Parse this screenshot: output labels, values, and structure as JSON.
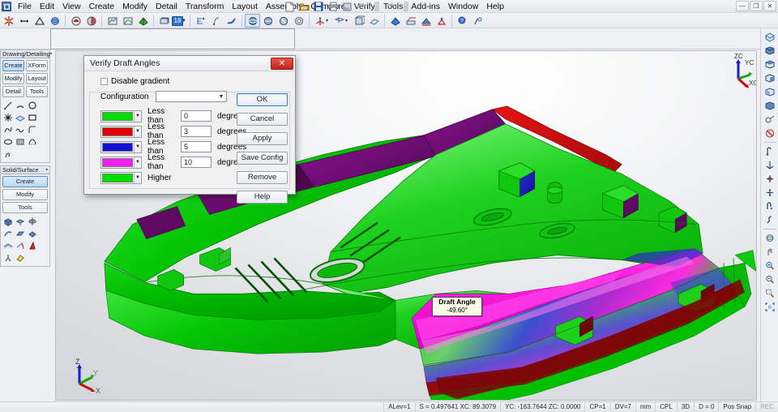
{
  "window": {
    "buttons": [
      {
        "name": "minimize",
        "glyph": "—"
      },
      {
        "name": "restore",
        "glyph": "❐"
      },
      {
        "name": "close",
        "glyph": "✕"
      }
    ]
  },
  "menubar": {
    "app_icon": "cad-app-icon",
    "items": [
      "File",
      "Edit",
      "View",
      "Create",
      "Modify",
      "Detail",
      "Transform",
      "Layout",
      "Assembly",
      "Compare",
      "Verify",
      "Tools",
      "Add-ins",
      "Window",
      "Help"
    ]
  },
  "title_icons": [
    {
      "name": "new-document-icon"
    },
    {
      "name": "open-folder-icon"
    },
    {
      "name": "save-icon"
    },
    {
      "name": "print-icon"
    },
    {
      "name": "save-as-icon"
    },
    {
      "name": "undo-icon"
    },
    {
      "name": "separator"
    },
    {
      "name": "redo-icon"
    },
    {
      "name": "separator2"
    }
  ],
  "toolbar": {
    "groups": [
      {
        "items": [
          {
            "name": "point-icon"
          },
          {
            "name": "line-icon"
          },
          {
            "name": "triangle-icon"
          },
          {
            "name": "shade-sphere-icon"
          }
        ]
      },
      {
        "items": [
          {
            "name": "render-object-icon"
          },
          {
            "name": "render-solid-icon"
          }
        ]
      },
      {
        "items": [
          {
            "name": "analysis-icon"
          },
          {
            "name": "curvature-icon"
          },
          {
            "name": "color-shade-icon"
          }
        ]
      },
      {
        "items": [
          {
            "name": "layer-icon"
          },
          {
            "name": "layer-number-button",
            "label": "18"
          },
          {
            "name": "layer-dropdown-arrow"
          }
        ]
      },
      {
        "items": [
          {
            "name": "attributes-icon"
          },
          {
            "name": "mask-icon"
          },
          {
            "name": "hook-icon"
          }
        ]
      },
      {
        "items": [
          {
            "name": "shade-mode-1-icon",
            "active": true
          },
          {
            "name": "shade-mode-2-icon"
          },
          {
            "name": "shade-mode-3-icon"
          },
          {
            "name": "shade-mode-4-icon"
          }
        ]
      },
      {
        "items": [
          {
            "name": "construction-plane-icon"
          },
          {
            "name": "cplane-arrow"
          },
          {
            "name": "view-window-icon"
          },
          {
            "name": "view-arrow"
          },
          {
            "name": "view-rotate-icon"
          },
          {
            "name": "view-plane-icon"
          }
        ]
      },
      {
        "items": [
          {
            "name": "draft-check-icon"
          },
          {
            "name": "section-icon"
          },
          {
            "name": "measure-icon"
          },
          {
            "name": "deviation-icon"
          }
        ]
      },
      {
        "items": [
          {
            "name": "help-pointer-icon"
          },
          {
            "name": "whats-this-icon"
          }
        ]
      }
    ]
  },
  "left_panels": [
    {
      "title": "Drawing/Detailing",
      "pin": "▪",
      "buttons": [
        {
          "label": "Create",
          "selected": true
        },
        {
          "label": "XForm",
          "selected": false
        },
        {
          "label": "Modify",
          "selected": false
        },
        {
          "label": "Layout",
          "selected": false
        },
        {
          "label": "Detail",
          "selected": false
        },
        {
          "label": "Tools",
          "selected": false
        }
      ],
      "icons": [
        {
          "name": "line-tool-icon"
        },
        {
          "name": "arc-tool-icon"
        },
        {
          "name": "circle-tool-icon"
        },
        {
          "name": "point-tool-icon"
        },
        {
          "name": "surface-tool-icon"
        },
        {
          "name": "rectangle-tool-icon"
        },
        {
          "name": "spline-tool-icon"
        },
        {
          "name": "curve-tool-icon"
        },
        {
          "name": "fillet-tool-icon"
        },
        {
          "name": "ellipse-tool-icon"
        },
        {
          "name": "grid-tool-icon"
        },
        {
          "name": "polyline-tool-icon"
        },
        {
          "name": "freeform-tool-icon"
        }
      ]
    },
    {
      "title": "Solid/Surface",
      "pin": "▪",
      "buttons": [
        {
          "label": "Create",
          "selected": true
        },
        {
          "label": "Modify",
          "selected": false
        },
        {
          "label": "Tools",
          "selected": false
        }
      ],
      "icons": [
        {
          "name": "box-solid-icon"
        },
        {
          "name": "extrude-solid-icon"
        },
        {
          "name": "revolve-solid-icon"
        },
        {
          "name": "sweep-solid-icon"
        },
        {
          "name": "loft-solid-icon"
        },
        {
          "name": "primitive-solid-icon"
        },
        {
          "name": "offset-surface-icon"
        },
        {
          "name": "trim-surface-icon"
        },
        {
          "name": "draft-angle-icon"
        },
        {
          "name": "split-surface-icon"
        },
        {
          "name": "patch-surface-icon"
        }
      ]
    }
  ],
  "right_toolbar": {
    "items": [
      {
        "name": "view-iso-icon"
      },
      {
        "name": "view-front-icon"
      },
      {
        "name": "view-top-icon"
      },
      {
        "name": "view-right-icon"
      },
      {
        "name": "view-back-icon"
      },
      {
        "name": "view-left-icon"
      },
      {
        "name": "view-named-icon"
      },
      {
        "name": "no-shade-icon"
      },
      {
        "name": "rotate-view-icon"
      },
      {
        "name": "axis-triad-icon"
      },
      {
        "name": "dynamic-rotate-icon"
      },
      {
        "name": "pan-center-icon"
      },
      {
        "name": "spin-view-icon"
      },
      {
        "name": "twist-view-icon"
      },
      {
        "name": "orbit-icon"
      },
      {
        "name": "pan-hand-icon"
      },
      {
        "name": "zoom-in-icon"
      },
      {
        "name": "zoom-out-icon"
      },
      {
        "name": "zoom-window-icon"
      },
      {
        "name": "zoom-fit-icon"
      }
    ]
  },
  "viewport": {
    "draft_tooltip": {
      "title": "Draft Angle",
      "value": "-49.60°"
    },
    "triad_top_right": {
      "labels": [
        "ZC",
        "YC",
        "XC"
      ]
    },
    "triad_bottom_left": {
      "labels": [
        "Z",
        "Y",
        "X"
      ]
    }
  },
  "dialog": {
    "title": "Verify Draft Angles",
    "close_glyph": "✕",
    "disable_gradient": {
      "label": "Disable gradient",
      "checked": false
    },
    "configuration": {
      "label": "Configuration",
      "value": "",
      "caret": "▼"
    },
    "rows": [
      {
        "color": "#00e000",
        "condition": "Less than",
        "value": "0",
        "unit": "degrees",
        "caret": "▼"
      },
      {
        "color": "#e00000",
        "condition": "Less than",
        "value": "3",
        "unit": "degrees",
        "caret": "▼"
      },
      {
        "color": "#1212d6",
        "condition": "Less than",
        "value": "5",
        "unit": "degrees",
        "caret": "▼"
      },
      {
        "color": "#f020f0",
        "condition": "Less than",
        "value": "10",
        "unit": "degrees",
        "caret": "▼"
      },
      {
        "color": "#00e000",
        "condition": "Higher",
        "value": "",
        "unit": "",
        "caret": "▼"
      }
    ],
    "buttons": [
      {
        "label": "OK",
        "primary": true
      },
      {
        "label": "Cancel",
        "primary": false
      },
      {
        "label": "Apply",
        "primary": false
      },
      {
        "label": "Save Config",
        "primary": false
      },
      {
        "label": "Remove",
        "primary": false
      },
      {
        "label": "Help",
        "primary": false
      }
    ]
  },
  "statusbar": {
    "cells": [
      "ALev=1",
      "S = 0.497641 XC: 89.3079",
      "YC: -163.7644 ZC: 0.0000",
      "CP=1",
      "DV=7",
      "mm",
      "CPL",
      "3D",
      "D = 0"
    ],
    "right": [
      "Pos Snap"
    ],
    "rec": "REC"
  }
}
